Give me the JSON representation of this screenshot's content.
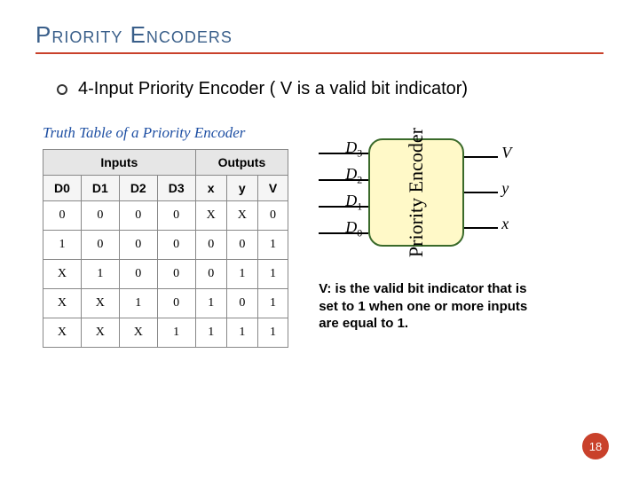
{
  "title": "Priority Encoders",
  "bullet": "4-Input Priority Encoder ( V is a valid bit indicator)",
  "truth_title": "Truth Table of a Priority Encoder",
  "headers": {
    "inputs": "Inputs",
    "outputs": "Outputs"
  },
  "cols": {
    "d0": "D0",
    "d1": "D1",
    "d2": "D2",
    "d3": "D3",
    "x": "x",
    "y": "y",
    "v": "V"
  },
  "rows": [
    {
      "d0": "0",
      "d1": "0",
      "d2": "0",
      "d3": "0",
      "x": "X",
      "y": "X",
      "v": "0"
    },
    {
      "d0": "1",
      "d1": "0",
      "d2": "0",
      "d3": "0",
      "x": "0",
      "y": "0",
      "v": "1"
    },
    {
      "d0": "X",
      "d1": "1",
      "d2": "0",
      "d3": "0",
      "x": "0",
      "y": "1",
      "v": "1"
    },
    {
      "d0": "X",
      "d1": "X",
      "d2": "1",
      "d3": "0",
      "x": "1",
      "y": "0",
      "v": "1"
    },
    {
      "d0": "X",
      "d1": "X",
      "d2": "X",
      "d3": "1",
      "x": "1",
      "y": "1",
      "v": "1"
    }
  ],
  "diagram": {
    "box_label": "Priority\nEncoder",
    "in": {
      "d3": "D",
      "d2": "D",
      "d1": "D",
      "d0": "D",
      "s3": "3",
      "s2": "2",
      "s1": "1",
      "s0": "0"
    },
    "out": {
      "v": "V",
      "y": "y",
      "x": "x"
    }
  },
  "explain": "V: is the valid bit indicator that is set to 1 when one or more inputs are equal to 1.",
  "page": "18"
}
